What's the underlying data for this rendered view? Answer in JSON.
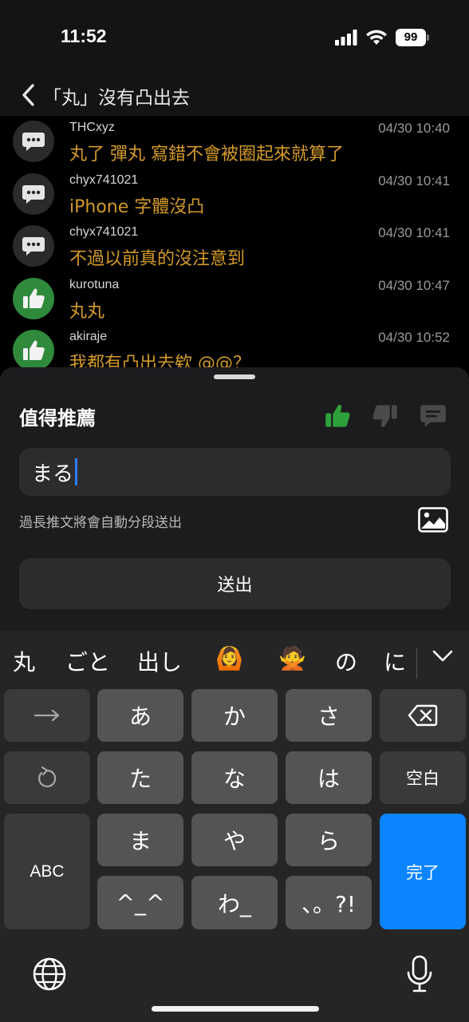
{
  "status_bar": {
    "time": "11:52",
    "battery": "99"
  },
  "nav": {
    "title": "「丸」沒有凸出去"
  },
  "comments": [
    {
      "user": "THCxyz",
      "time": "04/30 10:40",
      "text": "丸了 彈丸 寫錯不會被圈起來就算了",
      "avatar_icon": "comment-icon"
    },
    {
      "user": "chyx741021",
      "time": "04/30 10:41",
      "text": "iPhone 字體沒凸",
      "avatar_icon": "comment-icon"
    },
    {
      "user": "chyx741021",
      "time": "04/30 10:41",
      "text": "不過以前真的沒注意到",
      "avatar_icon": "comment-icon"
    },
    {
      "user": "kurotuna",
      "time": "04/30 10:47",
      "text": "丸丸",
      "avatar_icon": "thumbs-up-icon"
    },
    {
      "user": "akiraje",
      "time": "04/30 10:52",
      "text": "我都有凸出去欸 @@？",
      "avatar_icon": "thumbs-up-icon"
    }
  ],
  "composer": {
    "title": "值得推薦",
    "input_value": "まる",
    "hint": "過長推文將會自動分段送出",
    "send_label": "送出",
    "colors": {
      "active_vote": "#2fa03a",
      "comment_text": "#d39a2a",
      "caret": "#2b7cf7"
    }
  },
  "keyboard": {
    "candidates": [
      "丸",
      "ごと",
      "出し",
      "🙆",
      "🙅",
      "の",
      "に"
    ],
    "keys": {
      "a": "あ",
      "ka": "か",
      "sa": "さ",
      "ta": "た",
      "na": "な",
      "ha": "は",
      "ma": "ま",
      "ya": "や",
      "ra": "ら",
      "emoticon": "^_^",
      "wa": "わ_",
      "punct": "、。?!",
      "space": "空白",
      "abc": "ABC",
      "done": "完了"
    },
    "done_color": "#0a84ff"
  }
}
